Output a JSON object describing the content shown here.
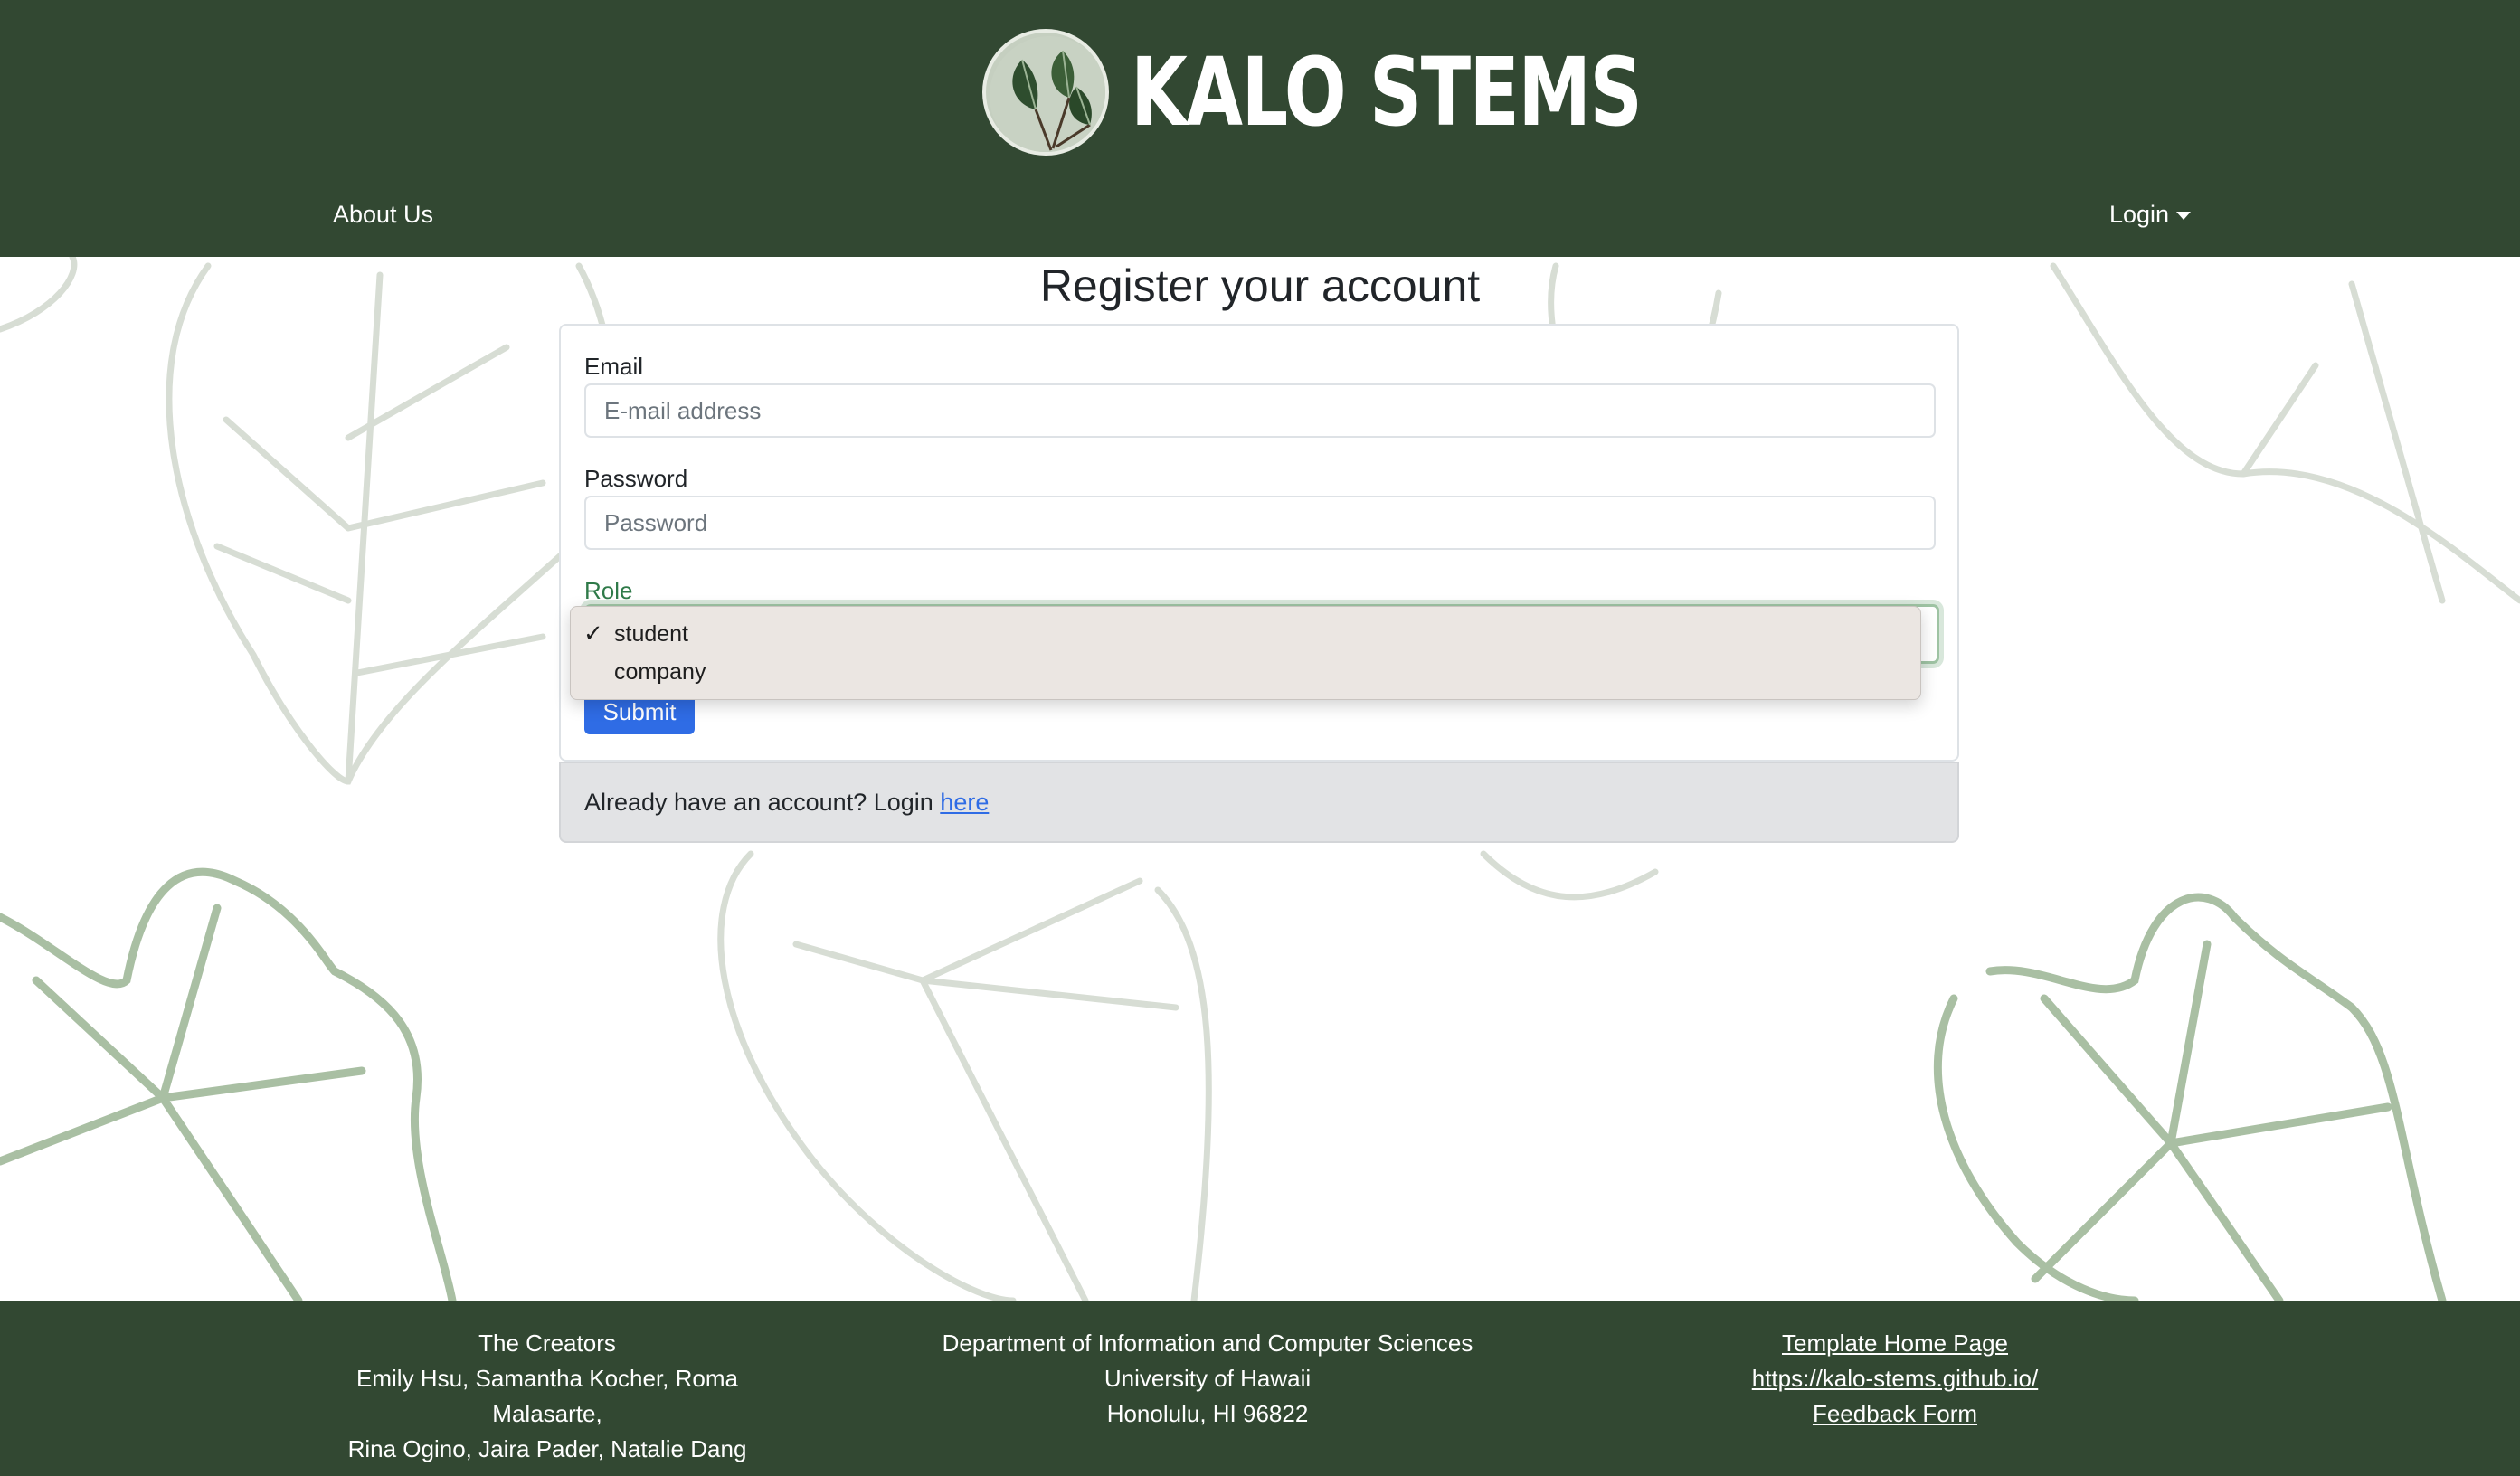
{
  "header": {
    "brand": "KALO STEMS",
    "nav_about": "About Us",
    "nav_login": "Login"
  },
  "main": {
    "title": "Register your account",
    "email_label": "Email",
    "email_placeholder": "E-mail address",
    "password_label": "Password",
    "password_placeholder": "Password",
    "role_label": "Role",
    "role_options": [
      "student",
      "company"
    ],
    "role_selected": "student",
    "submit_label": "Submit",
    "login_prompt": "Already have an account? Login",
    "login_link": "here"
  },
  "footer": {
    "creators_title": "The Creators",
    "creators_line1": "Emily Hsu, Samantha Kocher, Roma Malasarte,",
    "creators_line2": "Rina Ogino, Jaira Pader, Natalie Dang",
    "dept_line1": "Department of Information and Computer Sciences",
    "dept_line2": "University of Hawaii",
    "dept_line3": "Honolulu, HI 96822",
    "link_template": "Template Home Page",
    "link_site": "https://kalo-stems.github.io/",
    "link_feedback": "Feedback Form"
  },
  "colors": {
    "header_bg": "#324832",
    "accent": "#2f6ce5",
    "role_label": "#2f7a49",
    "leaf": "#a9bfa3"
  },
  "icons": {
    "logo": "taro-leaf-logo",
    "check": "check-icon",
    "caret": "caret-down-icon"
  }
}
